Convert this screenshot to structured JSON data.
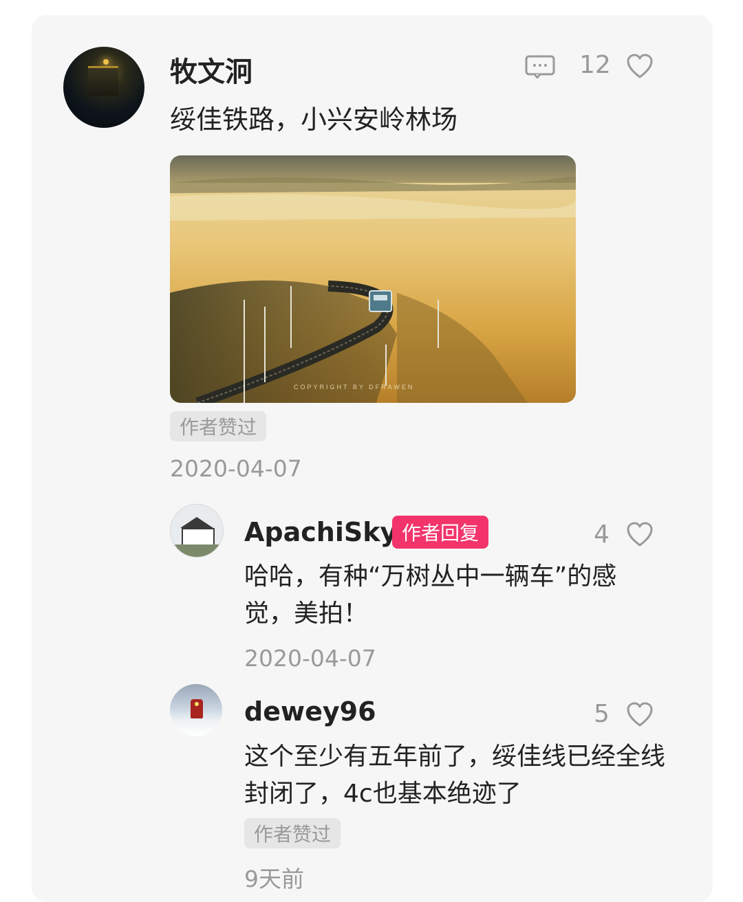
{
  "post": {
    "username": "牧文泂",
    "text": "绥佳铁路，小兴安岭林场",
    "comment_icon": "comment-icon",
    "like_count": "12",
    "like_icon": "heart-icon",
    "author_liked_tag": "作者赞过",
    "date": "2020-04-07",
    "photo_watermark": "COPYRIGHT  BY  DFRAWEN"
  },
  "replies": [
    {
      "username": "ApachiSky",
      "badge": "作者回复",
      "like_count": "4",
      "text": "哈哈，有种“万树丛中一辆车”的感觉，美拍！",
      "date": "2020-04-07"
    },
    {
      "username": "dewey96",
      "like_count": "5",
      "text": "这个至少有五年前了，绥佳线已经全线封闭了，4c也基本绝迹了",
      "author_liked_tag": "作者赞过",
      "date": "9天前"
    }
  ],
  "colors": {
    "card_bg": "#f6f6f6",
    "badge_pink": "#f2346b",
    "muted_text": "#999999"
  }
}
